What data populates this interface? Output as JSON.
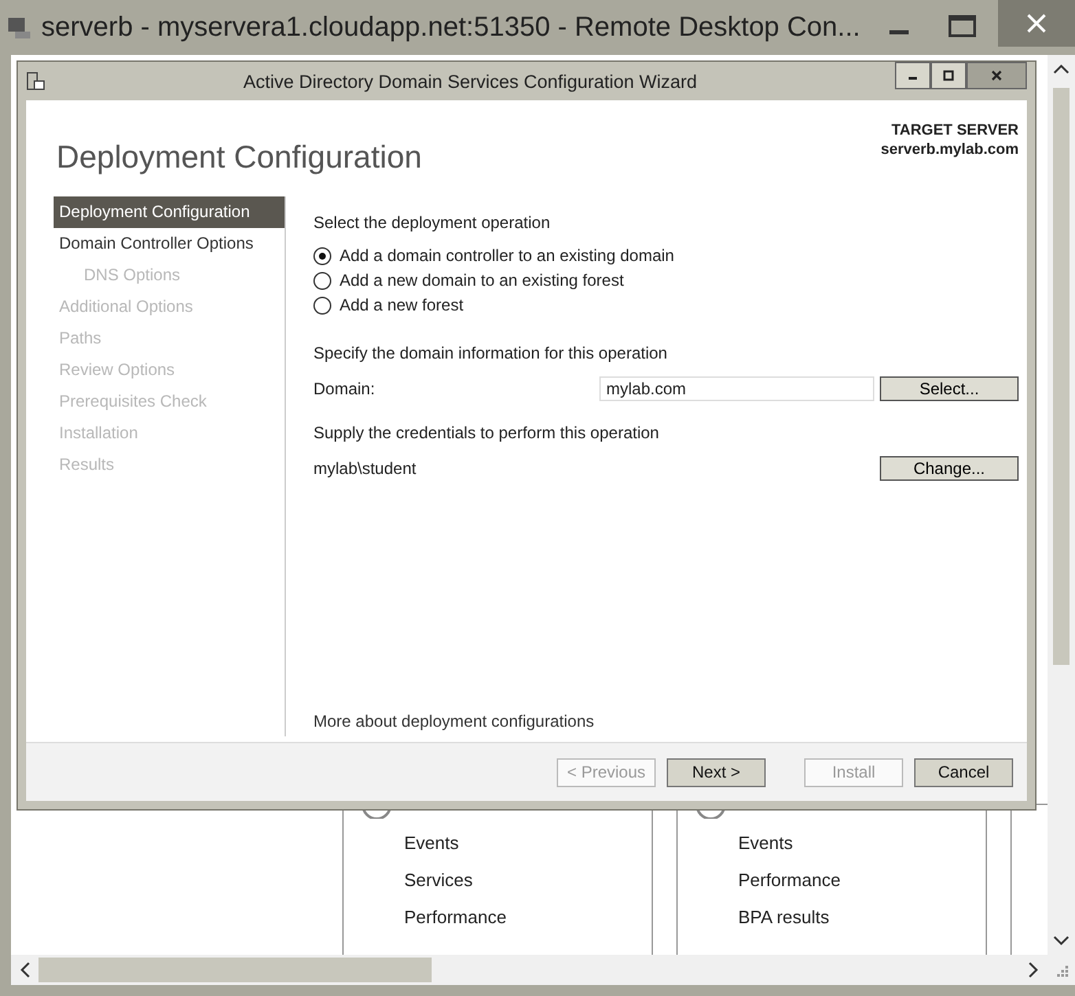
{
  "window": {
    "title": "serverb - myservera1.cloudapp.net:51350 - Remote Desktop Con..."
  },
  "dialog": {
    "title": "Active Directory Domain Services Configuration Wizard",
    "heading": "Deployment Configuration",
    "target_label": "TARGET SERVER",
    "target_server": "serverb.mylab.com",
    "steps": [
      {
        "label": "Deployment Configuration",
        "selected": true,
        "disabled": false
      },
      {
        "label": "Domain Controller Options",
        "selected": false,
        "disabled": false,
        "children": [
          {
            "label": "DNS Options",
            "selected": false,
            "disabled": true
          }
        ]
      },
      {
        "label": "Additional Options",
        "selected": false,
        "disabled": true
      },
      {
        "label": "Paths",
        "selected": false,
        "disabled": true
      },
      {
        "label": "Review Options",
        "selected": false,
        "disabled": true
      },
      {
        "label": "Prerequisites Check",
        "selected": false,
        "disabled": true
      },
      {
        "label": "Installation",
        "selected": false,
        "disabled": true
      },
      {
        "label": "Results",
        "selected": false,
        "disabled": true
      }
    ],
    "operation_prompt": "Select the deployment operation",
    "operations": [
      {
        "label": "Add a domain controller to an existing domain",
        "selected": true
      },
      {
        "label": "Add a new domain to an existing forest",
        "selected": false
      },
      {
        "label": "Add a new forest",
        "selected": false
      }
    ],
    "domain_prompt": "Specify the domain information for this operation",
    "domain_label": "Domain:",
    "domain_value": "mylab.com",
    "select_button": "Select...",
    "credentials_prompt": "Supply the credentials to perform this operation",
    "credentials_user": "mylab\\student",
    "change_button": "Change...",
    "more_link": "More about deployment configurations",
    "buttons": [
      {
        "label": "< Previous",
        "disabled": true
      },
      {
        "label": "Next >",
        "disabled": false
      },
      {
        "label": "Install",
        "disabled": true
      },
      {
        "label": "Cancel",
        "disabled": false
      }
    ]
  },
  "background_panels": [
    {
      "items": [
        "Events",
        "Services",
        "Performance"
      ]
    },
    {
      "items": [
        "Events",
        "Performance",
        "BPA results"
      ]
    }
  ]
}
